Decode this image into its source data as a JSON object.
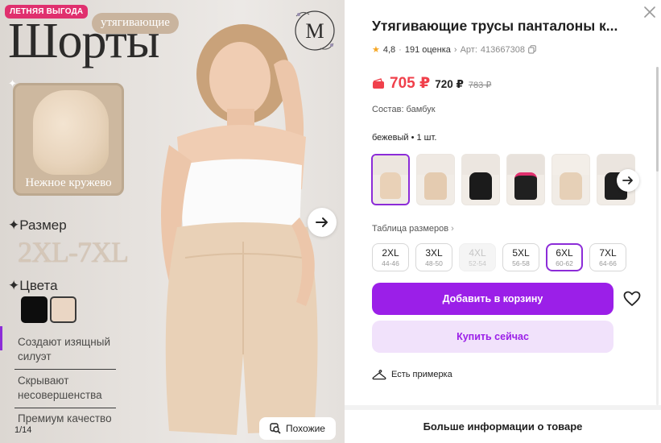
{
  "gallery": {
    "badge": "ЛЕТНЯЯ ВЫГОДА",
    "promo_sub": "утягивающие",
    "promo_title": "Шорты",
    "logo_letter": "M",
    "detail_caption": "Нежное кружево",
    "size_heading": "Размер",
    "size_range": "2XL-7XL",
    "color_heading": "Цвета",
    "swatch_colors": [
      "#0d0d0d",
      "#ead6c4"
    ],
    "benefits": [
      "Создают изящный силуэт",
      "Скрывают несовершенства",
      "Премиум качество"
    ],
    "counter": "1/14",
    "similar_label": "Похожие"
  },
  "product": {
    "title": "Утягивающие трусы панталоны к...",
    "rating": "4,8",
    "reviews": "191 оценка",
    "article_label": "Арт:",
    "article": "413667308",
    "price_wallet": "705 ₽",
    "price": "720 ₽",
    "price_old": "783 ₽",
    "composition": "Состав: бамбук",
    "color_line": "бежевый • 1 шт.",
    "size_table_label": "Таблица размеров",
    "sizes": [
      {
        "label": "2XL",
        "sub": "44-46",
        "state": "normal"
      },
      {
        "label": "3XL",
        "sub": "48-50",
        "state": "normal"
      },
      {
        "label": "4XL",
        "sub": "52-54",
        "state": "disabled"
      },
      {
        "label": "5XL",
        "sub": "56-58",
        "state": "normal"
      },
      {
        "label": "6XL",
        "sub": "60-62",
        "state": "selected"
      },
      {
        "label": "7XL",
        "sub": "64-66",
        "state": "normal"
      }
    ],
    "add_to_cart": "Добавить в корзину",
    "buy_now": "Купить сейчас",
    "fitting": "Есть примерка",
    "more_info": "Больше информации о товаре"
  },
  "colors": {
    "accent": "#9b1fe8",
    "price_red": "#f0404b",
    "badge_pink": "#e0306e"
  }
}
